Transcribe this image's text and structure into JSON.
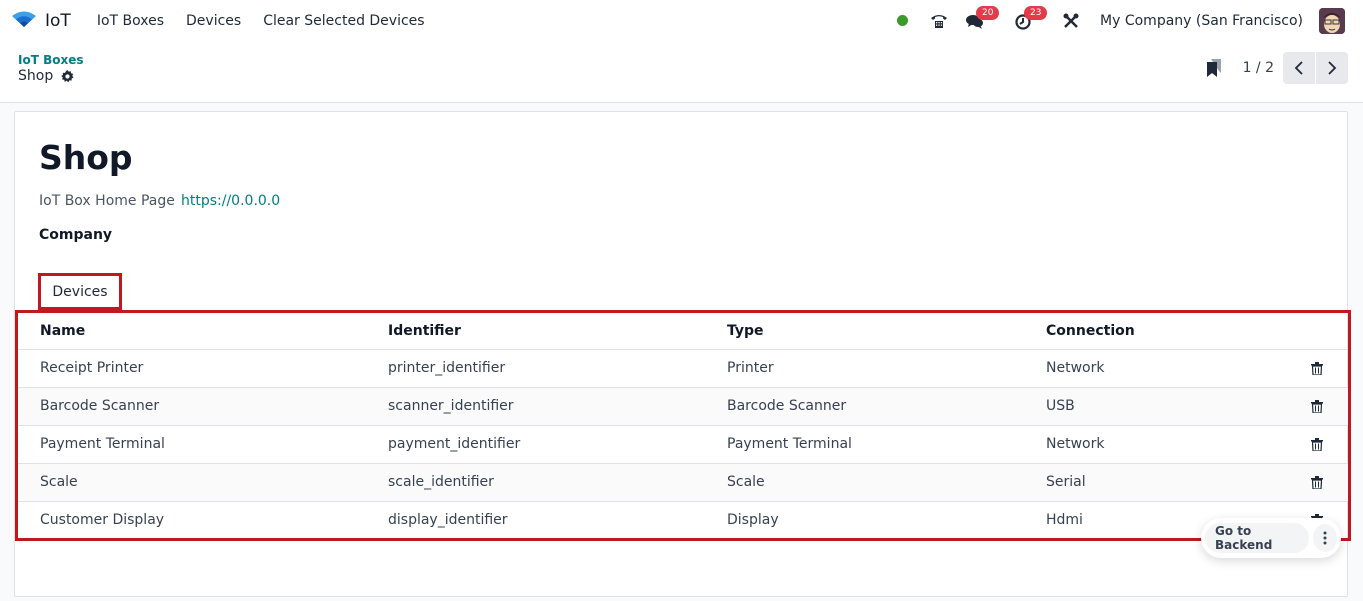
{
  "navbar": {
    "app_name": "IoT",
    "menu": [
      "IoT Boxes",
      "Devices",
      "Clear Selected Devices"
    ],
    "status_color": "#3a9a2a",
    "messages_count": "20",
    "activities_count": "23",
    "company": "My Company (San Francisco)"
  },
  "control_panel": {
    "breadcrumb_parent": "IoT Boxes",
    "breadcrumb_current": "Shop",
    "pager_value": "1 / 2"
  },
  "form": {
    "title": "Shop",
    "home_page_label": "IoT Box Home Page",
    "home_page_value": "https://0.0.0.0",
    "company_label": "Company",
    "company_value": ""
  },
  "tabs": [
    {
      "label": "Devices",
      "active": true
    }
  ],
  "devices_table": {
    "columns": [
      "Name",
      "Identifier",
      "Type",
      "Connection"
    ],
    "rows": [
      {
        "name": "Receipt Printer",
        "identifier": "printer_identifier",
        "type": "Printer",
        "connection": "Network"
      },
      {
        "name": "Barcode Scanner",
        "identifier": "scanner_identifier",
        "type": "Barcode Scanner",
        "connection": "USB"
      },
      {
        "name": "Payment Terminal",
        "identifier": "payment_identifier",
        "type": "Payment Terminal",
        "connection": "Network"
      },
      {
        "name": "Scale",
        "identifier": "scale_identifier",
        "type": "Scale",
        "connection": "Serial"
      },
      {
        "name": "Customer Display",
        "identifier": "display_identifier",
        "type": "Display",
        "connection": "Hdmi"
      }
    ]
  },
  "floating": {
    "backend_label": "Go to Backend"
  },
  "colors": {
    "accent": "#017e84",
    "highlight": "#c0181f",
    "badge": "#e33b49"
  }
}
